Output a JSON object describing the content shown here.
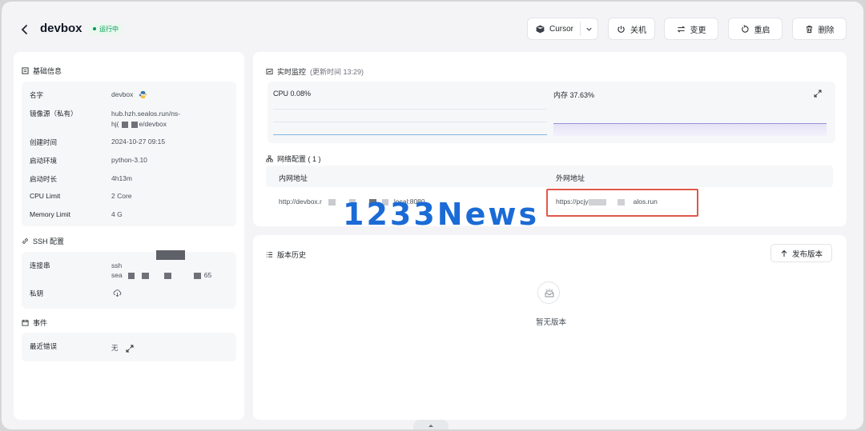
{
  "header": {
    "title": "devbox",
    "status": "运行中",
    "ide_button": "Cursor",
    "shutdown_button": "关机",
    "change_button": "变更",
    "restart_button": "重启",
    "delete_button": "删除"
  },
  "basic_info": {
    "title": "基础信息",
    "name_label": "名字",
    "name_value": "devbox",
    "image_label": "镜像源（私有）",
    "image_value_line1": "hub.hzh.sealos.run/ns-",
    "image_value_line2_prefix": "hj(",
    "image_value_line2_suffix": "e/devbox",
    "created_label": "创建时间",
    "created_value": "2024-10-27 09:15",
    "env_label": "启动环境",
    "env_value": "python-3.10",
    "uptime_label": "启动时长",
    "uptime_value": "4h13m",
    "cpu_label": "CPU Limit",
    "cpu_value": "2 Core",
    "memory_label": "Memory Limit",
    "memory_value": "4 G"
  },
  "ssh": {
    "title": "SSH 配置",
    "conn_label": "连接串",
    "conn_line1": "ssh",
    "conn_line2_prefix": "sea",
    "conn_line2_suffix": "65",
    "key_label": "私钥"
  },
  "events": {
    "title": "事件",
    "recent_error_label": "最近错误",
    "recent_error_value": "无"
  },
  "monitor": {
    "title": "实时监控",
    "updated": "(更新时间  13:29)",
    "cpu_label": "CPU 0.08%",
    "mem_label": "内存 37.63%",
    "cpu_percent": 0.08,
    "mem_percent": 37.63
  },
  "network": {
    "title": "网络配置 ( 1 )",
    "col_internal": "内网地址",
    "col_external": "外网地址",
    "internal_prefix": "http://devbox.r",
    "internal_suffix": "local:8080",
    "external_prefix": "https://pcjy",
    "external_suffix": "alos.run"
  },
  "versions": {
    "title": "版本历史",
    "publish_button": "发布版本",
    "empty_text": "暂无版本"
  },
  "watermark": "1233News",
  "colors": {
    "accent_line": "#7fb8e0",
    "mem_line": "#9b8fd8",
    "status_green": "#039855",
    "highlight_red": "#e0584a"
  }
}
